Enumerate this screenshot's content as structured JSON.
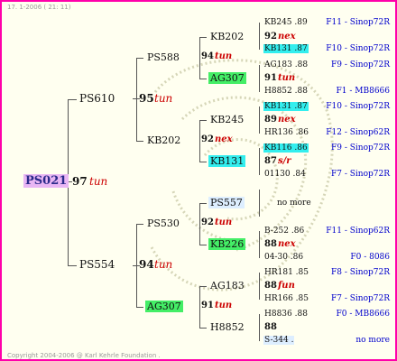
{
  "header": "17.  1-2006 ( 21: 11)",
  "footer": "Copyright 2004-2006 @ Karl Kehrle Foundation .",
  "root": {
    "id": "PS021",
    "rank": "97",
    "note": "tun"
  },
  "gen1": [
    {
      "id": "PS610",
      "rank": "95",
      "note": "tun"
    },
    {
      "id": "PS554",
      "rank": "94",
      "note": "tun"
    }
  ],
  "gen2": [
    {
      "id": "PS588",
      "rank": "94",
      "note": "tun"
    },
    {
      "id": "KB202",
      "rank": "92",
      "note": "nex"
    },
    {
      "id": "PS530",
      "rank": "92",
      "note": "tun"
    },
    {
      "id": "AG307",
      "rank": "91",
      "note": "tun"
    }
  ],
  "gen3": [
    {
      "id": "KB202",
      "rank": "92",
      "note": "nex"
    },
    {
      "id": "AG307",
      "rank": "91",
      "note": "tun"
    },
    {
      "id": "KB245",
      "rank": "89",
      "note": "nex"
    },
    {
      "id": "KB131",
      "rank": "87",
      "note": "s/r"
    },
    {
      "id": "PS557",
      "rank": "",
      "note": ""
    },
    {
      "id": "KB226",
      "rank": "88",
      "note": "nex"
    },
    {
      "id": "AG183",
      "rank": "88",
      "note": "fun"
    },
    {
      "id": "H8852",
      "rank": "88",
      "note": ""
    }
  ],
  "gen4": [
    {
      "id": "KB245 .89",
      "pos": "F11 - Sinop72R"
    },
    {
      "id": "KB131 .87",
      "pos": "F10 - Sinop72R"
    },
    {
      "id": "AG183 .88",
      "pos": "F9 - Sinop72R"
    },
    {
      "id": "H8852 .88",
      "pos": "F1 - MB8666"
    },
    {
      "id": "KB131 .87",
      "pos": "F10 - Sinop72R"
    },
    {
      "id": "HR136 .86",
      "pos": "F12 - Sinop62R"
    },
    {
      "id": "KB116 .86",
      "pos": "F9 - Sinop72R"
    },
    {
      "id": "01130 .84",
      "pos": "F7 - Sinop72R"
    },
    {
      "id": "no more",
      "pos": ""
    },
    {
      "id": "B-252 .86",
      "pos": "F11 - Sinop62R"
    },
    {
      "id": "04-30 .86",
      "pos": "F0 - 8086"
    },
    {
      "id": "HR181 .85",
      "pos": "F8 - Sinop72R"
    },
    {
      "id": "HR166 .85",
      "pos": "F7 - Sinop72R"
    },
    {
      "id": "H8836 .88",
      "pos": "F0 - MB8666"
    },
    {
      "id": "S-344 .",
      "pos": "no more"
    }
  ]
}
